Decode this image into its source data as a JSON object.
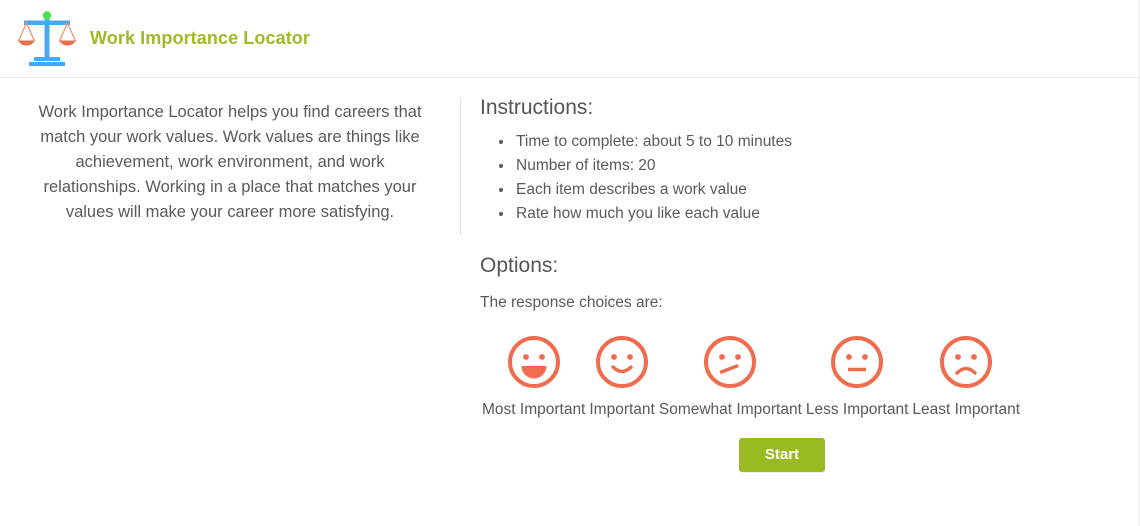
{
  "header": {
    "logo_icon": "balance-scale-icon",
    "title": "Work Importance Locator",
    "title_color": "#a2b827"
  },
  "intro": {
    "description": "Work Importance Locator helps you find careers that match your work values. Work values are things like achievement, work environment, and work relationships. Working in a place that matches your values will make your career more satisfying."
  },
  "instructions": {
    "heading": "Instructions:",
    "items": [
      "Time to complete: about 5 to 10 minutes",
      "Number of items: 20",
      "Each item describes a work value",
      "Rate how much you like each value"
    ]
  },
  "options": {
    "heading": "Options:",
    "subtitle": "The response choices are:",
    "accent_color": "#ef6d4e",
    "choices": [
      {
        "label": "Most Important",
        "icon": "grinning-face-icon"
      },
      {
        "label": "Important",
        "icon": "smiling-face-icon"
      },
      {
        "label": "Somewhat Important",
        "icon": "confused-face-icon"
      },
      {
        "label": "Less Important",
        "icon": "neutral-face-icon"
      },
      {
        "label": "Least Important",
        "icon": "frowning-face-icon"
      }
    ]
  },
  "actions": {
    "start_label": "Start",
    "start_color": "#9aba21"
  }
}
